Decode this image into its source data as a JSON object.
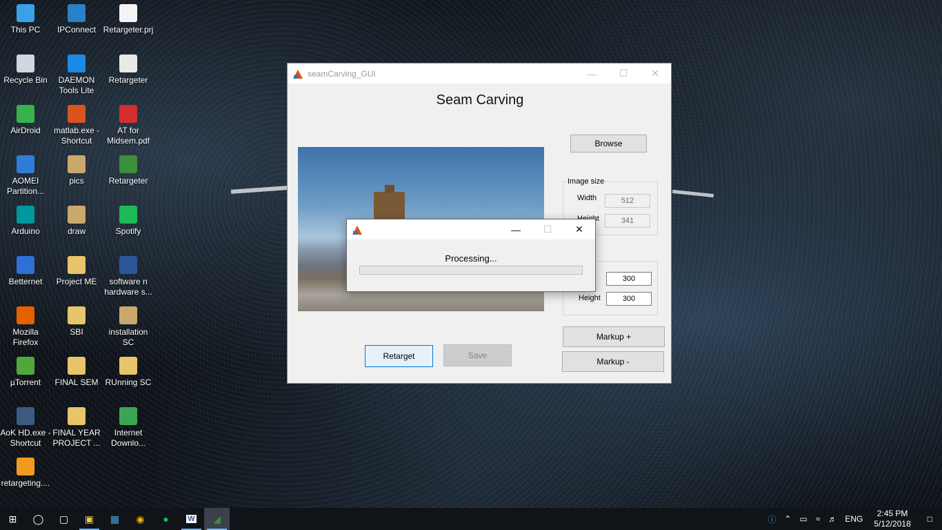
{
  "desktop_icons": [
    {
      "label": "This PC",
      "icon": "computer-icon",
      "color": "#3aa0e8"
    },
    {
      "label": "IPConnect",
      "icon": "network-user-icon",
      "color": "#2a7fc9"
    },
    {
      "label": "Retargeter.prj",
      "icon": "file-icon",
      "color": "#f4f4f4"
    },
    {
      "label": "Recycle Bin",
      "icon": "recycle-bin-icon",
      "color": "#cfd6dd"
    },
    {
      "label": "DAEMON Tools Lite",
      "icon": "daemon-tools-icon",
      "color": "#1e88e5"
    },
    {
      "label": "Retargeter",
      "icon": "chrome-html-file-icon",
      "color": "#e9e9e9"
    },
    {
      "label": "AirDroid",
      "icon": "airdroid-icon",
      "color": "#37b24d"
    },
    {
      "label": "matlab.exe - Shortcut",
      "icon": "matlab-icon",
      "color": "#d9541e"
    },
    {
      "label": "AT for Midsem.pdf",
      "icon": "pdf-icon",
      "color": "#d32f2f"
    },
    {
      "label": "AOMEI Partition...",
      "icon": "aomei-icon",
      "color": "#2e7dd7"
    },
    {
      "label": "pics",
      "icon": "folder-icon",
      "color": "#c9a86b"
    },
    {
      "label": "Retargeter",
      "icon": "retargeter-app-icon",
      "color": "#3b8f3b"
    },
    {
      "label": "Arduino",
      "icon": "arduino-icon",
      "color": "#00979d"
    },
    {
      "label": "draw",
      "icon": "folder-icon",
      "color": "#c9a86b"
    },
    {
      "label": "Spotify",
      "icon": "spotify-icon",
      "color": "#1db954"
    },
    {
      "label": "Betternet",
      "icon": "betternet-icon",
      "color": "#2f6fd6"
    },
    {
      "label": "Project ME",
      "icon": "zip-folder-icon",
      "color": "#e8c46a"
    },
    {
      "label": "software n hardware s...",
      "icon": "word-document-icon",
      "color": "#2b579a"
    },
    {
      "label": "Mozilla Firefox",
      "icon": "firefox-icon",
      "color": "#e66000"
    },
    {
      "label": "SBI",
      "icon": "zip-folder-icon",
      "color": "#e8c46a"
    },
    {
      "label": "installation SC",
      "icon": "folder-icon",
      "color": "#c9a86b"
    },
    {
      "label": "µTorrent",
      "icon": "utorrent-icon",
      "color": "#4fa83d"
    },
    {
      "label": "FINAL SEM",
      "icon": "zip-folder-icon",
      "color": "#e8c46a"
    },
    {
      "label": "RUnning SC",
      "icon": "folder-icon",
      "color": "#e8c46a"
    },
    {
      "label": "AoK HD.exe - Shortcut",
      "icon": "aok-icon",
      "color": "#3d5a80"
    },
    {
      "label": "FINAL YEAR PROJECT ...",
      "icon": "zip-folder-icon",
      "color": "#e8c46a"
    },
    {
      "label": "Internet Downlo...",
      "icon": "idm-icon",
      "color": "#3aa655"
    },
    {
      "label": "retargeting....",
      "icon": "orange-app-icon",
      "color": "#f29a1e"
    }
  ],
  "main_window": {
    "title": "seamCarving_GUI",
    "heading": "Seam Carving",
    "browse_label": "Browse",
    "image_size": {
      "legend": "Image size",
      "width_label": "Width",
      "width_value": "512",
      "height_label": "Height",
      "height_value": "341"
    },
    "target_size": {
      "legend_visible": "e",
      "width_label_visible": "h",
      "width_value": "300",
      "height_label": "Height",
      "height_value": "300"
    },
    "markup_plus_label": "Markup +",
    "markup_minus_label": "Markup -",
    "retarget_label": "Retarget",
    "save_label": "Save"
  },
  "dialog": {
    "message": "Processing...",
    "progress": 0
  },
  "taskbar": {
    "language": "ENG",
    "time": "2:45 PM",
    "date": "5/12/2018"
  }
}
